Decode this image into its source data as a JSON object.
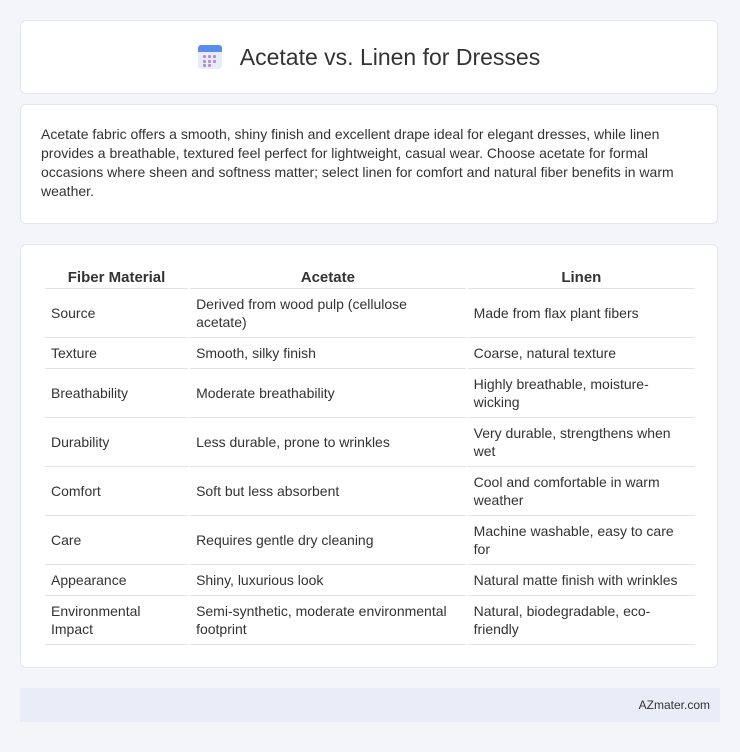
{
  "header": {
    "title": "Acetate vs. Linen for Dresses",
    "icon": "calendar-icon"
  },
  "summary": {
    "text": "Acetate fabric offers a smooth, shiny finish and excellent drape ideal for elegant dresses, while linen provides a breathable, textured feel perfect for lightweight, casual wear. Choose acetate for formal occasions where sheen and softness matter; select linen for comfort and natural fiber benefits in warm weather."
  },
  "table": {
    "headers": [
      "Fiber Material",
      "Acetate",
      "Linen"
    ],
    "rows": [
      [
        "Source",
        "Derived from wood pulp (cellulose acetate)",
        "Made from flax plant fibers"
      ],
      [
        "Texture",
        "Smooth, silky finish",
        "Coarse, natural texture"
      ],
      [
        "Breathability",
        "Moderate breathability",
        "Highly breathable, moisture-wicking"
      ],
      [
        "Durability",
        "Less durable, prone to wrinkles",
        "Very durable, strengthens when wet"
      ],
      [
        "Comfort",
        "Soft but less absorbent",
        "Cool and comfortable in warm weather"
      ],
      [
        "Care",
        "Requires gentle dry cleaning",
        "Machine washable, easy to care for"
      ],
      [
        "Appearance",
        "Shiny, luxurious look",
        "Natural matte finish with wrinkles"
      ],
      [
        "Environmental Impact",
        "Semi-synthetic, moderate environmental footprint",
        "Natural, biodegradable, eco-friendly"
      ]
    ]
  },
  "footer": {
    "brand": "AZmater.com"
  }
}
